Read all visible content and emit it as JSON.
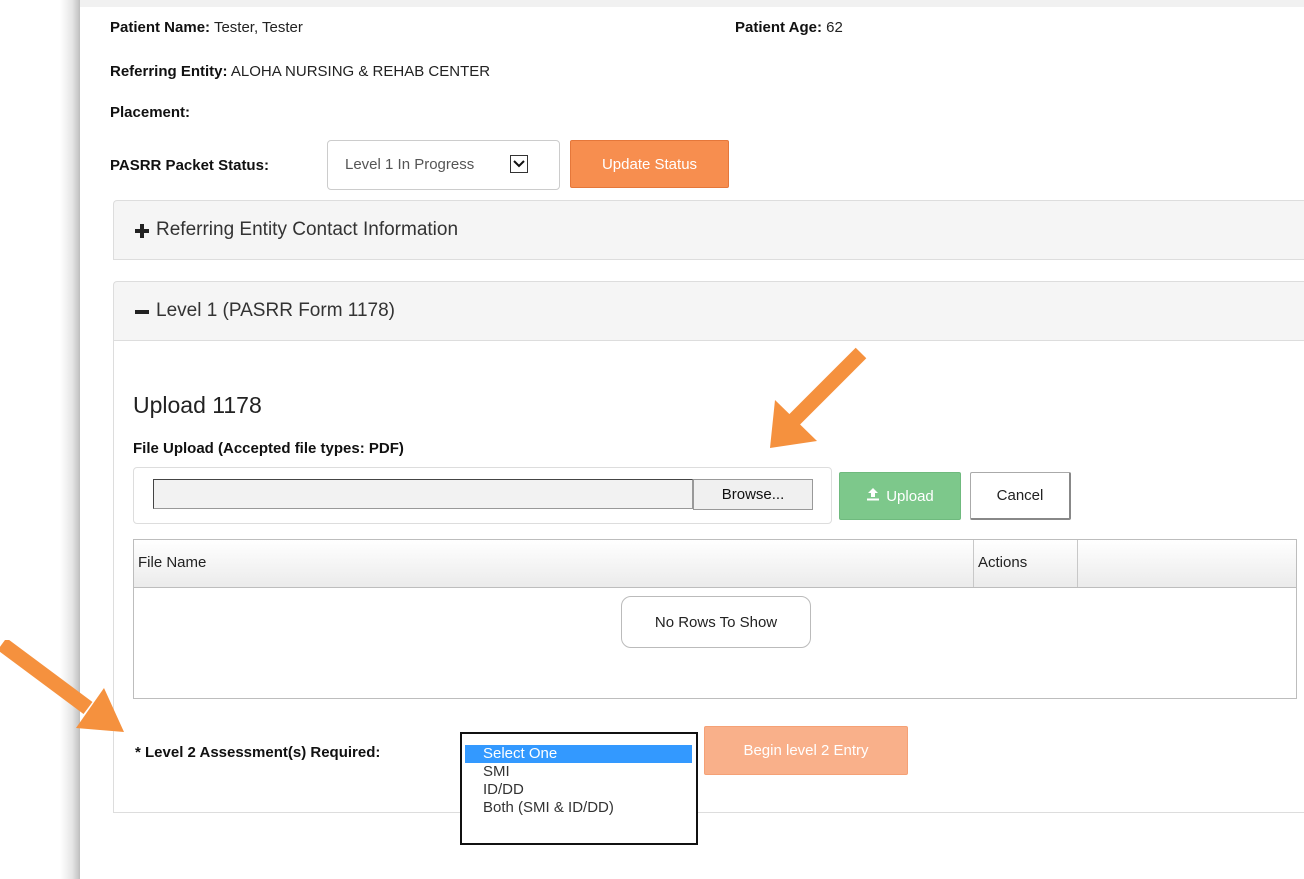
{
  "patient": {
    "name_label": "Patient Name:",
    "name_value": "Tester, Tester",
    "age_label": "Patient Age:",
    "age_value": "62",
    "referring_label": "Referring Entity:",
    "referring_value": "ALOHA NURSING & REHAB CENTER",
    "placement_label": "Placement:",
    "placement_value": ""
  },
  "status": {
    "label": "PASRR Packet Status:",
    "selected": "Level 1 In Progress",
    "update_button": "Update Status"
  },
  "panels": {
    "contact_title": "Referring Entity Contact Information",
    "level1_title": "Level 1 (PASRR Form 1178)"
  },
  "upload": {
    "title": "Upload 1178",
    "subtitle": "File Upload (Accepted file types: PDF)",
    "browse_button": "Browse...",
    "upload_button": "Upload",
    "cancel_button": "Cancel"
  },
  "grid": {
    "columns": [
      "File Name",
      "Actions",
      ""
    ],
    "empty_message": "No Rows To Show"
  },
  "level2": {
    "label": "* Level 2 Assessment(s) Required:",
    "options": [
      "Select One",
      "SMI",
      "ID/DD",
      "Both (SMI & ID/DD)"
    ],
    "selected_index": 0,
    "begin_button": "Begin level 2 Entry"
  },
  "colors": {
    "orange_button": "#f78e4f",
    "orange_disabled": "#f9b08a",
    "green_button": "#7dc88b",
    "selection_blue": "#3399ff",
    "arrow_orange": "#f5913e"
  }
}
